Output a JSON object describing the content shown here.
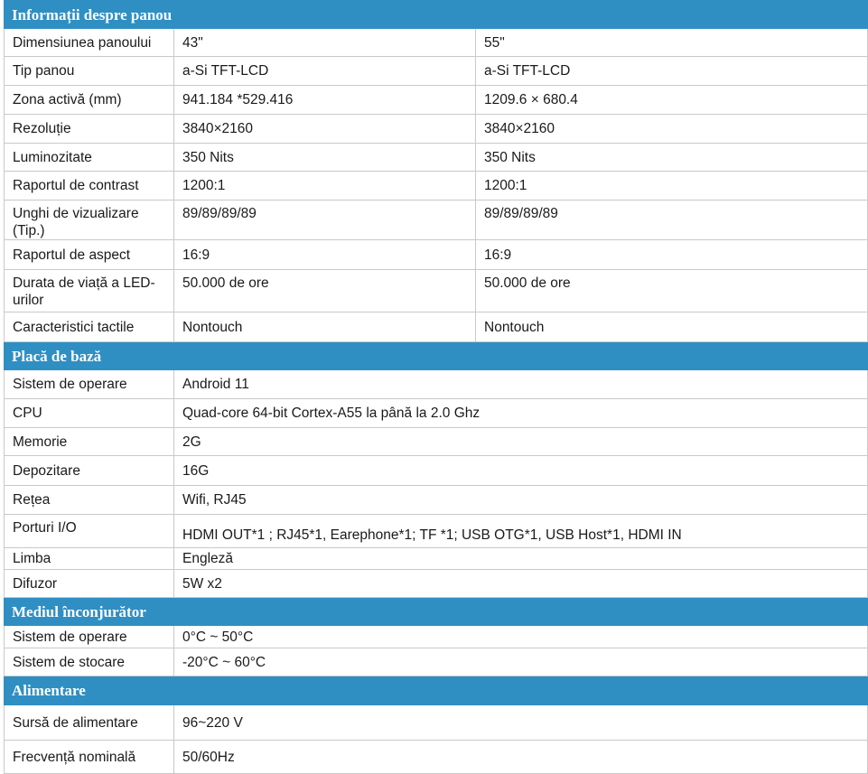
{
  "sections": {
    "panel": {
      "title": "Informații despre panou",
      "rows": [
        {
          "label": "Dimensiunea panoului",
          "v43": "43\"",
          "v55": "55\""
        },
        {
          "label": "Tip panou",
          "v43": "a-Si TFT-LCD",
          "v55": "a-Si TFT-LCD"
        },
        {
          "label": "Zona activă (mm)",
          "v43": "941.184 *529.416",
          "v55": "1209.6 × 680.4"
        },
        {
          "label": "Rezoluție",
          "v43": "3840×2160",
          "v55": "3840×2160"
        },
        {
          "label": "Luminozitate",
          "v43": "350 Nits",
          "v55": "350 Nits"
        },
        {
          "label": "Raportul de contrast",
          "v43": "1200:1",
          "v55": "1200:1"
        },
        {
          "label": "Unghi de vizualizare (Tip.)",
          "v43": "89/89/89/89",
          "v55": "89/89/89/89"
        },
        {
          "label": "Raportul de aspect",
          "v43": "16:9",
          "v55": "16:9"
        },
        {
          "label": "Durata de viață a LED-urilor",
          "v43": "50.000 de ore",
          "v55": "50.000 de ore"
        },
        {
          "label": "Caracteristici tactile",
          "v43": "Nontouch",
          "v55": "Nontouch"
        }
      ]
    },
    "board": {
      "title": "Placă de bază",
      "rows": [
        {
          "label": "Sistem de operare",
          "value": "Android 11"
        },
        {
          "label": "CPU",
          "value": "Quad-core 64-bit Cortex-A55 la până la 2.0 Ghz"
        },
        {
          "label": "Memorie",
          "value": "2G"
        },
        {
          "label": "Depozitare",
          "value": "16G"
        },
        {
          "label": "Rețea",
          "value": "Wifi, RJ45"
        },
        {
          "label": "Porturi I/O",
          "value": "HDMI OUT*1 ; RJ45*1, Earephone*1;  TF *1;  USB OTG*1,  USB Host*1, HDMI IN"
        },
        {
          "label": "Limba",
          "value": "Engleză"
        },
        {
          "label": "Difuzor",
          "value": "5W x2"
        }
      ]
    },
    "environment": {
      "title": "Mediul înconjurător",
      "rows": [
        {
          "label": "Sistem de operare",
          "value": "0°C ~ 50°C"
        },
        {
          "label": "Sistem de stocare",
          "value": "-20°C ~ 60°C"
        }
      ]
    },
    "power": {
      "title": "Alimentare",
      "rows": [
        {
          "label": "Sursă de alimentare",
          "value": "96~220 V"
        },
        {
          "label": "Frecvență nominală",
          "value": "50/60Hz"
        }
      ]
    }
  }
}
